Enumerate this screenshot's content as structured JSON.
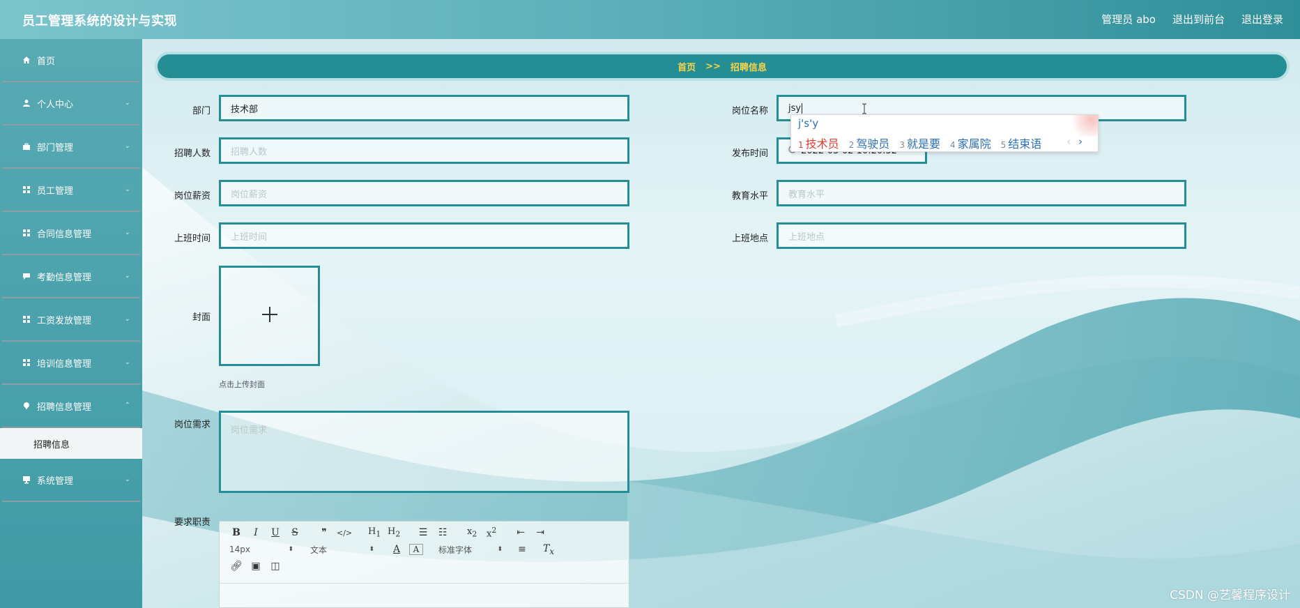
{
  "header": {
    "title": "员工管理系统的设计与实现",
    "user_label": "管理员 abo",
    "front_link": "退出到前台",
    "logout_link": "退出登录"
  },
  "sidebar": {
    "items": [
      {
        "label": "首页",
        "icon": "home-icon"
      },
      {
        "label": "个人中心",
        "icon": "user-icon"
      },
      {
        "label": "部门管理",
        "icon": "briefcase-icon"
      },
      {
        "label": "员工管理",
        "icon": "grid-icon"
      },
      {
        "label": "合同信息管理",
        "icon": "grid-icon"
      },
      {
        "label": "考勤信息管理",
        "icon": "comment-icon"
      },
      {
        "label": "工资发放管理",
        "icon": "grid-icon"
      },
      {
        "label": "培训信息管理",
        "icon": "grid-icon"
      },
      {
        "label": "招聘信息管理",
        "icon": "pin-icon"
      },
      {
        "label": "系统管理",
        "icon": "monitor-icon"
      }
    ],
    "active_sub": "招聘信息"
  },
  "breadcrumb": {
    "home": "首页",
    "separator": ">>",
    "current": "招聘信息"
  },
  "form": {
    "department": {
      "label": "部门",
      "value": "技术部"
    },
    "position_name": {
      "label": "岗位名称",
      "value": "jsy"
    },
    "headcount": {
      "label": "招聘人数",
      "placeholder": "招聘人数"
    },
    "publish_time": {
      "label": "发布时间",
      "value": "2022-03-02 10:20:52"
    },
    "salary": {
      "label": "岗位薪资",
      "placeholder": "岗位薪资"
    },
    "education": {
      "label": "教育水平",
      "placeholder": "教育水平"
    },
    "work_hours": {
      "label": "上班时间",
      "placeholder": "上班时间"
    },
    "work_location": {
      "label": "上班地点",
      "placeholder": "上班地点"
    },
    "cover": {
      "label": "封面",
      "hint": "点击上传封面"
    },
    "requirements": {
      "label": "岗位需求",
      "placeholder": "岗位需求"
    },
    "duties": {
      "label": "要求职责"
    }
  },
  "editor": {
    "font_size": "14px",
    "block_type": "文本",
    "font_family": "标准字体"
  },
  "ime": {
    "composition": "j's'y",
    "candidates": [
      {
        "n": "1",
        "text": "技术员"
      },
      {
        "n": "2",
        "text": "驾驶员"
      },
      {
        "n": "3",
        "text": "就是要"
      },
      {
        "n": "4",
        "text": "家属院"
      },
      {
        "n": "5",
        "text": "结束语"
      }
    ],
    "prev": "‹",
    "next": "›"
  },
  "watermark": "CSDN @艺馨程序设计",
  "colors": {
    "primary": "#248e94",
    "breadcrumb_text": "#f6d54a",
    "ime_selected": "#e23b2f",
    "ime_candidate": "#2b6fb5"
  }
}
